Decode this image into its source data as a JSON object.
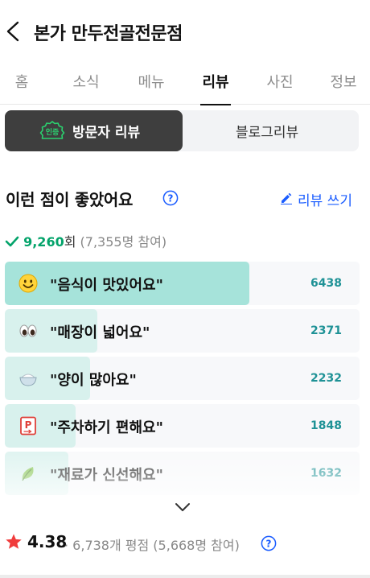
{
  "header": {
    "title": "본가 만두전골전문점"
  },
  "tabs": [
    {
      "label": "홈",
      "active": false
    },
    {
      "label": "소식",
      "active": false
    },
    {
      "label": "메뉴",
      "active": false
    },
    {
      "label": "리뷰",
      "active": true
    },
    {
      "label": "사진",
      "active": false
    },
    {
      "label": "정보",
      "active": false
    }
  ],
  "segment": {
    "badge": "인증",
    "visitor_label": "방문자 리뷰",
    "blog_label": "블로그리뷰"
  },
  "section": {
    "title": "이런 점이 좋았어요",
    "write_label": "리뷰 쓰기"
  },
  "stats": {
    "count": "9,260",
    "unit": "회",
    "participants": "(7,355명 참여)"
  },
  "keywords": [
    {
      "label": "\"음식이 맛있어요\"",
      "count": "6438",
      "icon": "smiling-face-icon",
      "ratio": 0.69
    },
    {
      "label": "\"매장이 넓어요\"",
      "count": "2371",
      "icon": "eyes-icon",
      "ratio": 0.26
    },
    {
      "label": "\"양이 많아요\"",
      "count": "2232",
      "icon": "rice-bowl-icon",
      "ratio": 0.24
    },
    {
      "label": "\"주차하기 편해요\"",
      "count": "1848",
      "icon": "parking-icon",
      "ratio": 0.2
    },
    {
      "label": "\"재료가 신선해요\"",
      "count": "1632",
      "icon": "leaf-icon",
      "ratio": 0.18
    }
  ],
  "rating": {
    "score": "4.38",
    "meta": "· 6,738개 평점 (5,668명 참여)"
  },
  "colors": {
    "accent_blue": "#1a5cff",
    "bar_fill": "#a6e3da",
    "count_teal": "#1f9296",
    "check_green": "#03a36a",
    "star_red": "#f03c3c"
  }
}
